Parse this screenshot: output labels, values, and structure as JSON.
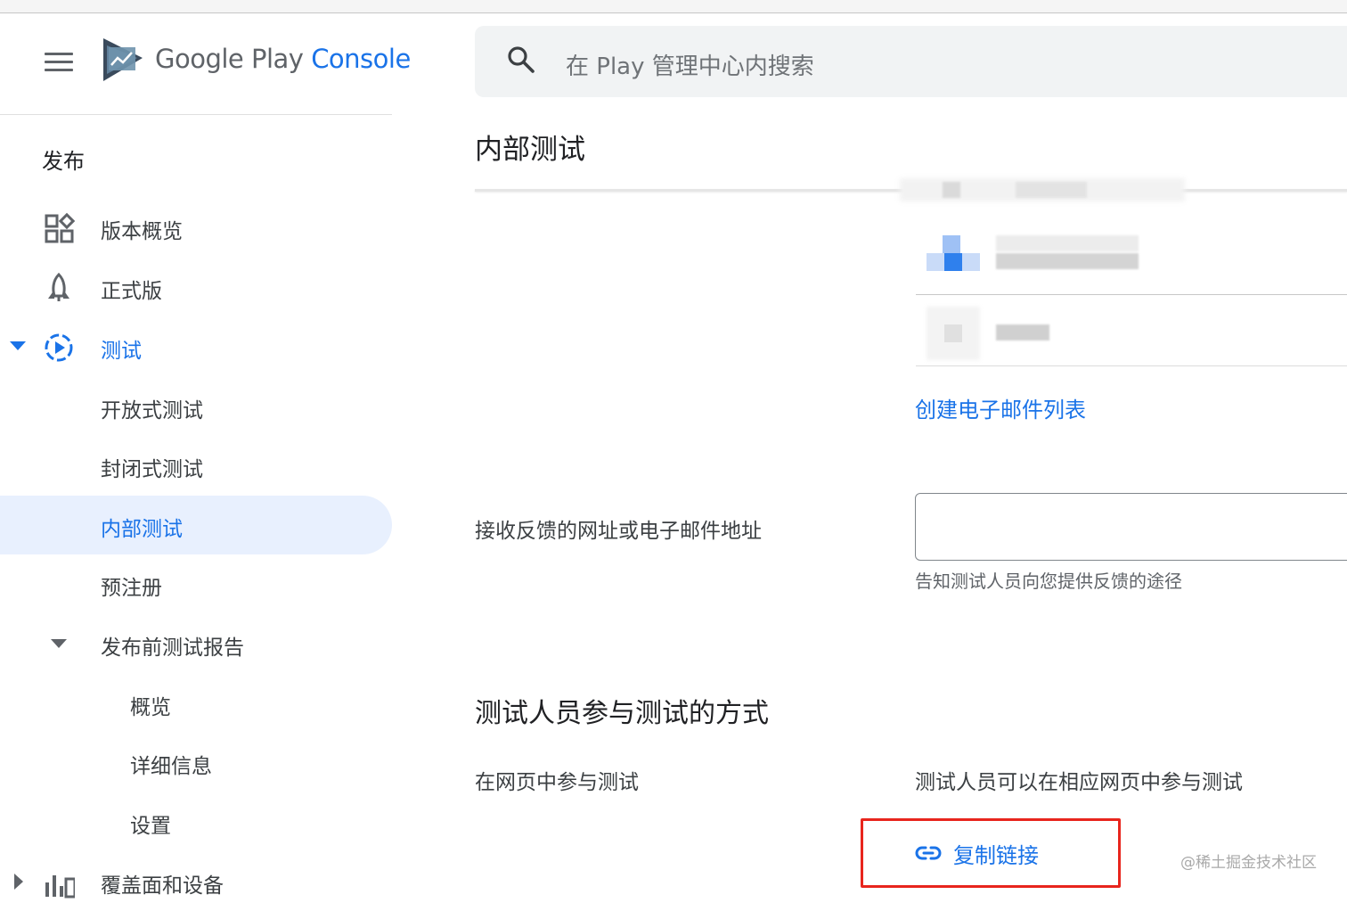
{
  "app": {
    "brand_google_play": "Google Play",
    "brand_console": "Console"
  },
  "search": {
    "placeholder": "在 Play 管理中心内搜索"
  },
  "sidebar": {
    "section_title": "发布",
    "items": [
      {
        "label": "版本概览",
        "icon": "dashboard-grid-icon"
      },
      {
        "label": "正式版",
        "icon": "rocket-icon"
      },
      {
        "label": "测试",
        "icon": "play-circle-icon",
        "expanded": true,
        "active": true
      },
      {
        "label": "开放式测试"
      },
      {
        "label": "封闭式测试"
      },
      {
        "label": "内部测试",
        "selected": true
      },
      {
        "label": "预注册"
      },
      {
        "label": "发布前测试报告",
        "expanded": true
      },
      {
        "label": "概览"
      },
      {
        "label": "详细信息"
      },
      {
        "label": "设置"
      },
      {
        "label": "覆盖面和设备",
        "icon": "bar-chart-icon",
        "expanded": false
      }
    ]
  },
  "main": {
    "page_title": "内部测试",
    "create_email_list": "创建电子邮件列表",
    "feedback": {
      "label": "接收反馈的网址或电子邮件地址",
      "value": "",
      "helper": "告知测试人员向您提供反馈的途径"
    },
    "participation": {
      "section_title": "测试人员参与测试的方式",
      "row_label": "在网页中参与测试",
      "row_value": "测试人员可以在相应网页中参与测试",
      "copy_link": "复制链接"
    }
  },
  "watermark": "@稀土掘金技术社区",
  "colors": {
    "accent": "#1a73e8",
    "selected_bg": "#e8f0fe",
    "highlight_border": "#e8251d"
  }
}
